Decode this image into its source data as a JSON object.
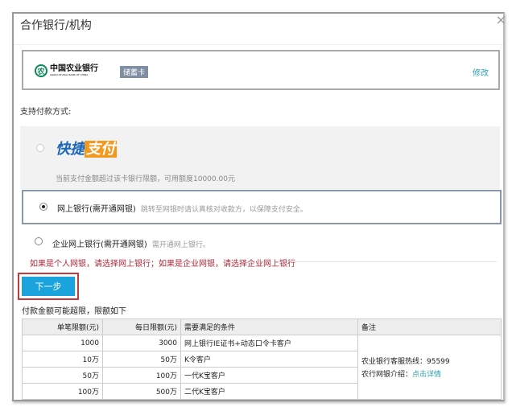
{
  "dialog": {
    "title": "合作银行/机构",
    "close": "×"
  },
  "bank": {
    "name_zh": "中国农业银行",
    "name_en": "AGRICULTURAL BANK OF CHINA",
    "card_type": "储蓄卡",
    "edit": "修改"
  },
  "support_label": "支持付款方式:",
  "options": {
    "quick": {
      "logo_a": "快捷",
      "logo_b": "支付",
      "note": "当前支付金额超过该卡银行限额，可用额度10000.00元",
      "selected": false,
      "disabled": true
    },
    "online": {
      "label": "网上银行(需开通网银)",
      "note": "跳转至网银时请认真核对收款方，以保障支付安全。",
      "selected": true
    },
    "enterprise": {
      "label": "企业网上银行(需开通网银)",
      "note": "需开通网上银行。",
      "selected": false
    }
  },
  "tip": "如果是个人网银，请选择网上银行；如果是企业网银，请选择企业网上银行",
  "next_button": "下一步",
  "limit_title": "付款金额可能超限，限额如下",
  "table": {
    "headers": [
      "单笔限额(元)",
      "每日限额(元)",
      "需要满足的条件",
      "备注"
    ],
    "rows": [
      [
        "1000",
        "3000",
        "网上银行IE证书+动态口令卡客户"
      ],
      [
        "10万",
        "50万",
        "K令客户"
      ],
      [
        "50万",
        "100万",
        "一代K宝客户"
      ],
      [
        "100万",
        "500万",
        "二代K宝客户"
      ]
    ],
    "remark_hotline": "农业银行客服热线：95599",
    "remark_intro": "农行网银介绍：",
    "remark_link": "点击详情"
  }
}
